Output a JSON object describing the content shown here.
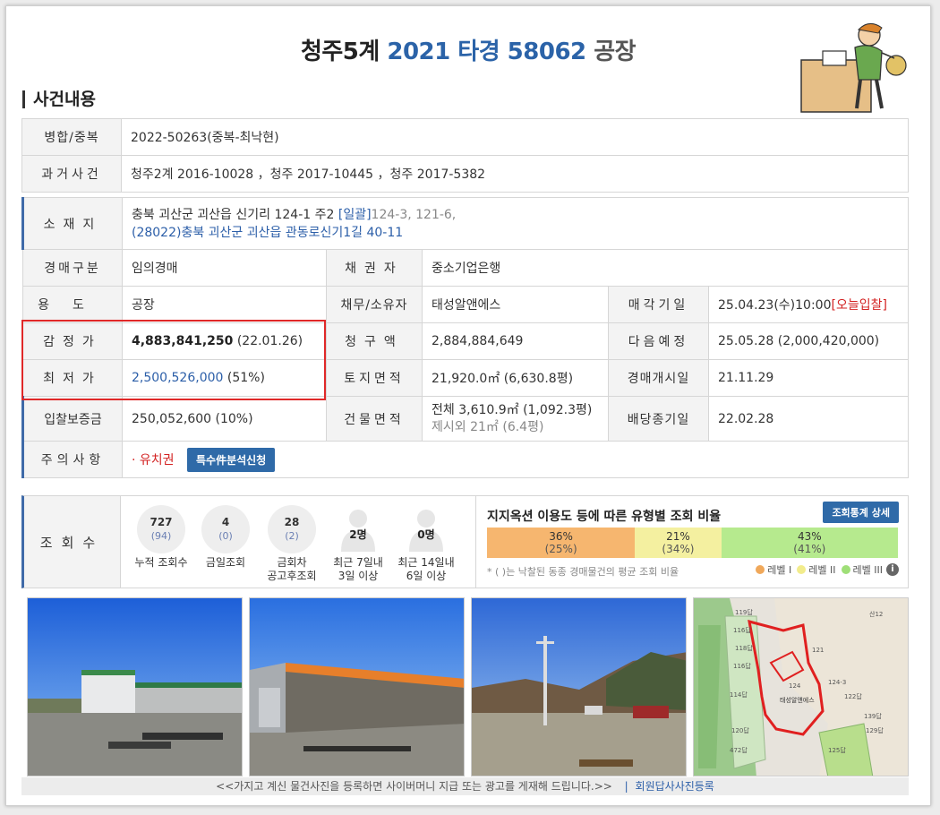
{
  "header": {
    "court": "청주5계",
    "case_no": "2021 타경 58062",
    "kind": "공장",
    "section_title": "사건내용"
  },
  "top_rows": [
    {
      "label": "병합/중복",
      "value": "2022-50263(중복-최낙현)"
    },
    {
      "label": "과거사건",
      "value": "청주2계 2016-10028 ，청주 2017-10445 ，청주 2017-5382"
    }
  ],
  "location": {
    "label": "소재지",
    "line1": "충북 괴산군 괴산읍 신기리 124-1 주2",
    "bulk_tag": "[일괄]",
    "bulk_lots": "124-3, 121-6,",
    "line2": "(28022)충북 괴산군  괴산읍 관동로신기1길  40-11"
  },
  "details": {
    "auction_type_label": "경매구분",
    "auction_type": "임의경매",
    "creditor_label": "채권자",
    "creditor": "중소기업은행",
    "usage_label": "용도",
    "usage": "공장",
    "debtor_label": "채무/소유자",
    "debtor": "태성알앤에스",
    "sale_date_label": "매각기일",
    "sale_date": "25.04.23(수)10:00",
    "sale_tag": "[오늘입찰]",
    "appraisal_label": "감정가",
    "appraisal": "4,883,841,250",
    "appraisal_date": "(22.01.26)",
    "claim_label": "청구액",
    "claim": "2,884,884,649",
    "next_label": "다음예정",
    "next": "25.05.28 (2,000,420,000)",
    "min_label": "최저가",
    "min_price": "2,500,526,000",
    "min_pct": "(51%)",
    "land_label": "토지면적",
    "land": "21,920.0㎡ (6,630.8평)",
    "start_label": "경매개시일",
    "start": "21.11.29",
    "deposit_label": "입찰보증금",
    "deposit": "250,052,600 (10%)",
    "bldg_label": "건물면적",
    "bldg1": "전체 3,610.9㎡ (1,092.3평)",
    "bldg2": "제시외 21㎡ (6.4평)",
    "divend_label": "배당종기일",
    "divend": "22.02.28",
    "caution_label": "주의사항",
    "caution": "· 유치권",
    "caution_btn": "특수件분석신청"
  },
  "views": {
    "label": "조회수",
    "stats": [
      {
        "n": "727",
        "sub": "(94)",
        "cap1": "누적 조회수",
        "cap2": ""
      },
      {
        "n": "4",
        "sub": "(0)",
        "cap1": "금일조회",
        "cap2": ""
      },
      {
        "n": "28",
        "sub": "(2)",
        "cap1": "금회차",
        "cap2": "공고후조회"
      },
      {
        "n": "2명",
        "sub": "",
        "cap1": "최근 7일내",
        "cap2": "3일 이상"
      },
      {
        "n": "0명",
        "sub": "",
        "cap1": "최근 14일내",
        "cap2": "6일 이상"
      }
    ]
  },
  "ratio": {
    "title": "지지옥션 이용도 등에 따른 유형별 조회 비율",
    "button": "조회통계 상세",
    "segments": [
      {
        "pct": "36%",
        "sub": "(25%)",
        "value": 36,
        "color": "#f6b66f"
      },
      {
        "pct": "21%",
        "sub": "(34%)",
        "value": 21,
        "color": "#f4f0a0"
      },
      {
        "pct": "43%",
        "sub": "(41%)",
        "value": 43,
        "color": "#b6ea8e"
      }
    ],
    "note": "* ( )는 낙찰된 동종 경매물건의 평균 조회 비율",
    "legend": [
      {
        "label": "레벨 I",
        "color": "#f0a85a"
      },
      {
        "label": "레벨 II",
        "color": "#f2ec8c"
      },
      {
        "label": "레벨 III",
        "color": "#9fdf78"
      }
    ],
    "info": "i"
  },
  "map": {
    "lots": [
      "119답",
      "116답",
      "118답",
      "116답",
      "114답",
      "120답",
      "472답",
      "124",
      "125답",
      "129답",
      "122답",
      "산12",
      "139답",
      "121",
      "124-3"
    ],
    "company": "태성알앤에스"
  },
  "footer": {
    "caption": "<<가지고 계신 물건사진을 등록하면 사이버머니 지급 또는 광고를 게재해 드립니다.>>",
    "divider": "|",
    "link": "회원답사사진등록"
  }
}
